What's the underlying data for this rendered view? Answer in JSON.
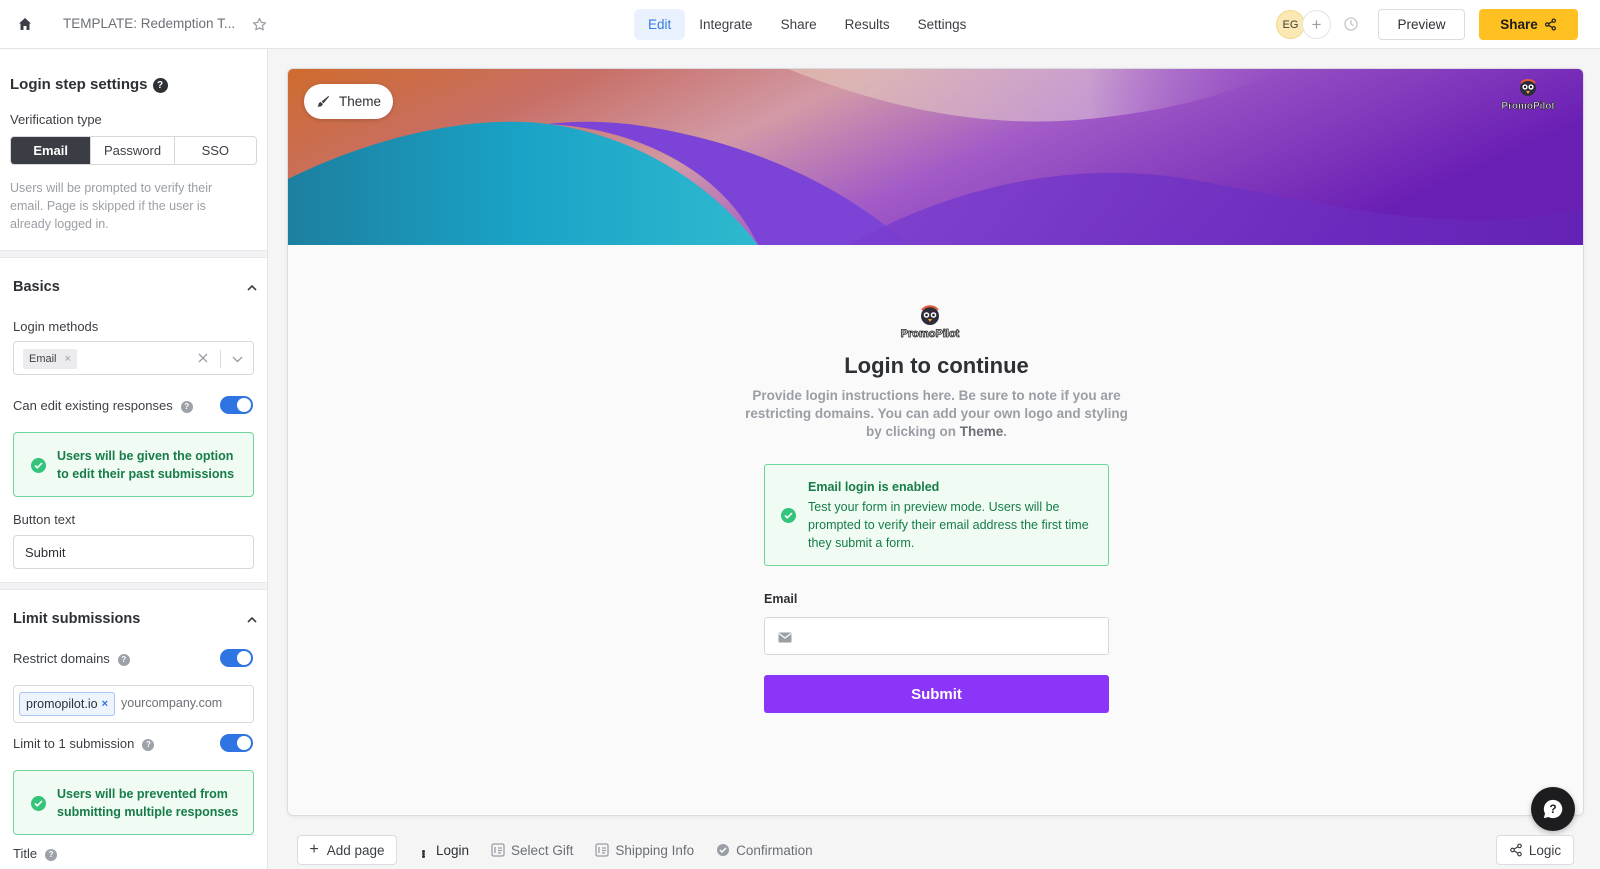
{
  "topbar": {
    "doc_title": "TEMPLATE: Redemption T...",
    "nav": [
      "Edit",
      "Integrate",
      "Share",
      "Results",
      "Settings"
    ],
    "active_nav": "Edit",
    "avatar_initials": "EG",
    "add_collaborator": "+",
    "preview_label": "Preview",
    "share_label": "Share",
    "share_color": "#ffc121"
  },
  "left": {
    "step_title": "Login step settings",
    "verification_label": "Verification type",
    "verification_options": [
      "Email",
      "Password",
      "SSO"
    ],
    "verification_selected": "Email",
    "verification_hint": "Users will be prompted to verify their email. Page is skipped if the user is already logged in.",
    "basics": {
      "title": "Basics",
      "login_methods_label": "Login methods",
      "login_methods_selected": "Email",
      "can_edit_label": "Can edit existing responses",
      "can_edit_on": true,
      "can_edit_note": "Users will be given the option to edit their past submissions",
      "button_text_label": "Button text",
      "button_text_value": "Submit"
    },
    "limit": {
      "title": "Limit submissions",
      "restrict_label": "Restrict domains",
      "restrict_on": true,
      "domain_tag": "promopilot.io",
      "domain_placeholder": "yourcompany.com",
      "limit_one_label": "Limit to 1 submission",
      "limit_one_on": true,
      "limit_note": "Users will be prevented from submitting multiple responses",
      "next_label": "Title"
    }
  },
  "canvas": {
    "theme_label": "Theme",
    "logo_text": "PromoPilot",
    "login_title": "Login to continue",
    "login_sub_before": "Provide login instructions here. Be sure to note if you are restricting domains. You can add your own logo and styling by clicking on ",
    "login_sub_emph": "Theme",
    "login_sub_after": ".",
    "info_heading": "Email login is enabled",
    "info_body": "Test your form in preview mode. Users will be prompted to verify their email address the first time they submit a form.",
    "email_label": "Email",
    "submit_label": "Submit",
    "accent_color": "#8a35f7"
  },
  "bottom": {
    "add_page_label": "Add page",
    "pages": [
      "Login",
      "Select Gift",
      "Shipping Info",
      "Confirmation"
    ],
    "active_page": "Login",
    "logic_label": "Logic"
  }
}
